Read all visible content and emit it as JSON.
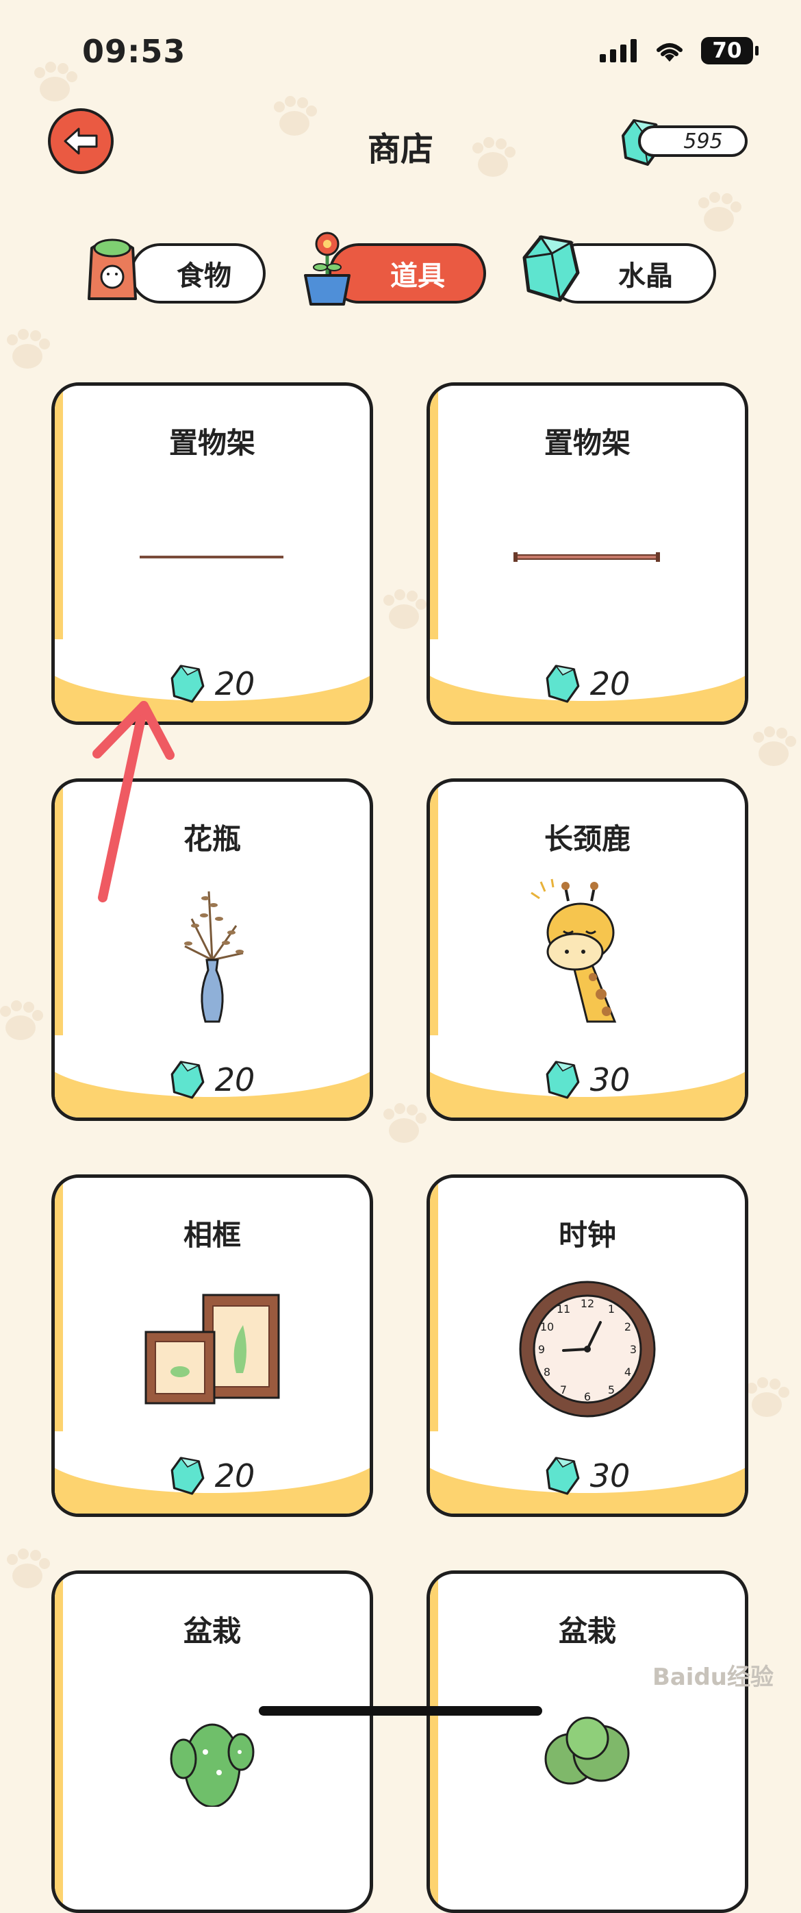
{
  "status_bar": {
    "time": "09:53",
    "battery": "70"
  },
  "header": {
    "title": "商店",
    "gem_balance": "595"
  },
  "tabs": [
    {
      "label": "食物",
      "icon": "food-bag-icon",
      "active": false
    },
    {
      "label": "道具",
      "icon": "flower-pot-icon",
      "active": true
    },
    {
      "label": "水晶",
      "icon": "crystal-icon",
      "active": false
    }
  ],
  "items": [
    {
      "name": "置物架",
      "price": "20",
      "icon": "shelf-plain-icon"
    },
    {
      "name": "置物架",
      "price": "20",
      "icon": "shelf-bracket-icon"
    },
    {
      "name": "花瓶",
      "price": "20",
      "icon": "vase-icon"
    },
    {
      "name": "长颈鹿",
      "price": "30",
      "icon": "giraffe-icon"
    },
    {
      "name": "相框",
      "price": "20",
      "icon": "photo-frame-icon"
    },
    {
      "name": "时钟",
      "price": "30",
      "icon": "clock-icon"
    },
    {
      "name": "盆栽",
      "price": "",
      "icon": "cactus-plant-icon"
    },
    {
      "name": "盆栽",
      "price": "",
      "icon": "shrub-plant-icon"
    }
  ],
  "colors": {
    "accent": "#ea5a42",
    "card_base": "#fdd36f",
    "background": "#fbf4e6",
    "gem": "#5ee4cf"
  },
  "watermark": "Baidu经验"
}
